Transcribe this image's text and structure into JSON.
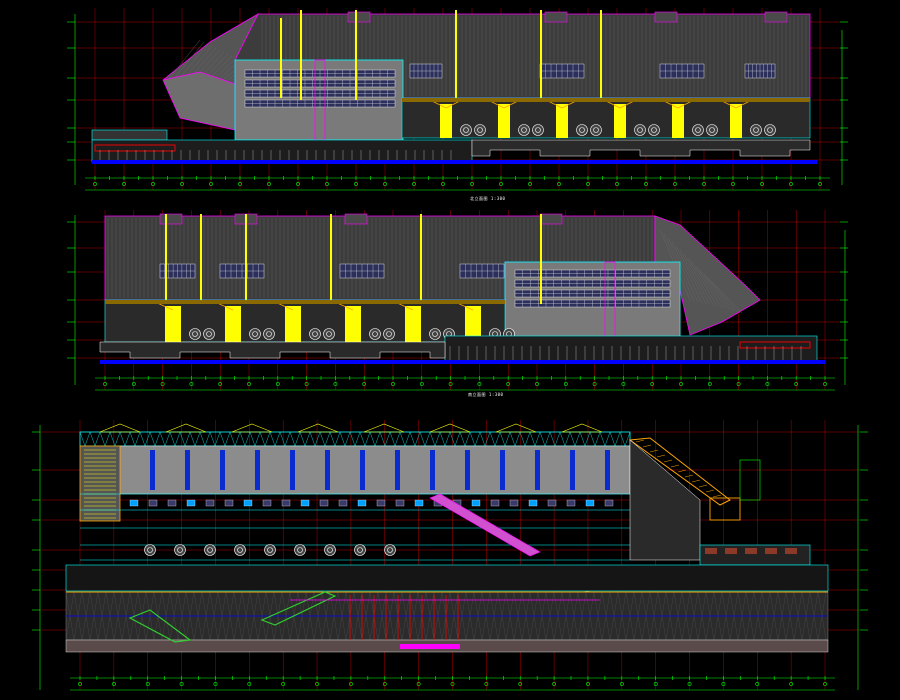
{
  "drawing": {
    "background": "#000000",
    "colors": {
      "roof": "#3c3c3c",
      "roof_line": "#5a5a5a",
      "facade": "#7a7a7a",
      "grid": "#b00000",
      "dim": "#00ff00",
      "yellow": "#ffff00",
      "magenta": "#ff00ff",
      "cyan": "#00ffff",
      "blue": "#0000ff",
      "red": "#ff0000",
      "orange": "#ffa500",
      "white": "#ffffff",
      "soil": "#9a9a9a"
    },
    "views": [
      {
        "id": "elevation-1",
        "caption": "北立面图  1:300"
      },
      {
        "id": "elevation-2",
        "caption": "南立面图  1:300"
      },
      {
        "id": "section-1",
        "caption": ""
      }
    ]
  }
}
